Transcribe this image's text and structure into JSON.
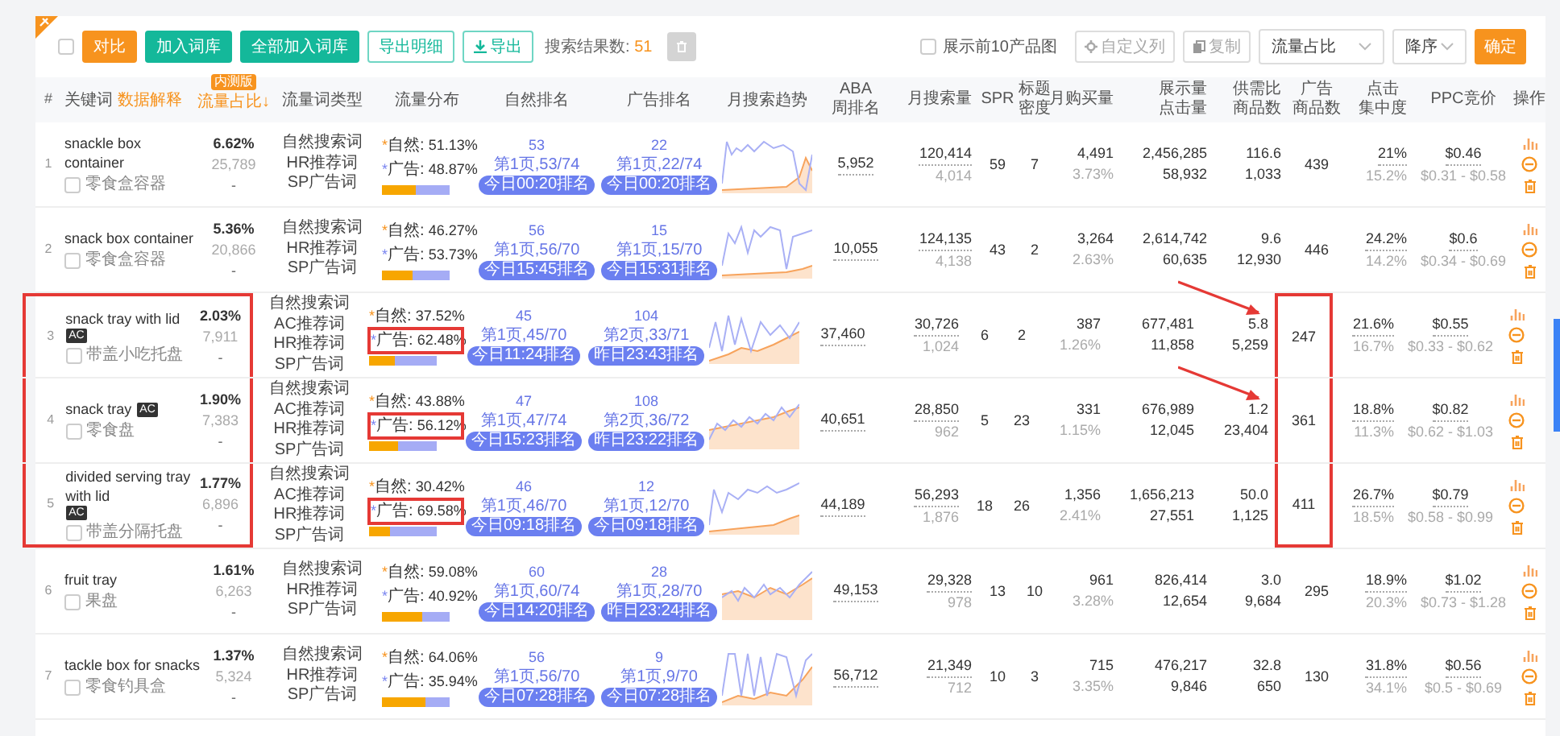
{
  "toolbar": {
    "select_all": {
      "checked": false
    },
    "buttons": [
      {
        "kind": "orange",
        "label": "对比"
      },
      {
        "kind": "green",
        "label": "加入词库"
      },
      {
        "kind": "green",
        "label": "全部加入词库"
      },
      {
        "kind": "outline",
        "label": "导出明细"
      },
      {
        "kind": "outline-download",
        "label": "导出"
      }
    ],
    "result_label": "搜索结果数:",
    "result_count": "51",
    "show_top10": {
      "label": "展示前10产品图",
      "checked": false
    },
    "custom_columns": "自定义列",
    "copy": "复制",
    "sort_field": "流量占比",
    "sort_order": "降序",
    "confirm": "确定"
  },
  "columns": {
    "index": "#",
    "keyword": "关键词",
    "keyword_link": "数据解释",
    "share_badge": "内测版",
    "share": "流量占比↓",
    "type": "流量词类型",
    "distribution": "流量分布",
    "natural_rank": "自然排名",
    "ad_rank": "广告排名",
    "trend": "月搜索趋势",
    "aba": [
      "ABA",
      "周排名"
    ],
    "search": [
      "月搜索量"
    ],
    "spr": [
      "SPR"
    ],
    "density": [
      "标题",
      "密度"
    ],
    "purchases": [
      "月购买量"
    ],
    "impressions": [
      "展示量",
      "点击量"
    ],
    "supply": [
      "供需比",
      "商品数"
    ],
    "ad_products": [
      "广告",
      "商品数"
    ],
    "click": [
      "点击",
      "集中度"
    ],
    "ppc": [
      "PPC竞价"
    ],
    "actions": [
      "操作"
    ]
  },
  "rows": [
    {
      "index": "1",
      "checked": false,
      "keyword": "snackle box container",
      "translation": "零食盒容器",
      "share": "6.62%",
      "volume": "25,789",
      "share_note": "-",
      "types": [
        "自然搜索词",
        "HR推荐词",
        "SP广告词"
      ],
      "distribution": {
        "natural_label": "*自然:",
        "natural": "51.13%",
        "ad_label": "*广告:",
        "ad": "48.87%",
        "level": 0.5113
      },
      "natural_rank": {
        "rank": "53",
        "page": "第1页,53/74",
        "tag": "今日00:20排名"
      },
      "ad_rank": {
        "rank": "22",
        "page": "第1页,22/74",
        "tag": "今日00:20排名"
      },
      "aba": "5,952",
      "search": "120,414",
      "search_sub": "4,014",
      "spr": "59",
      "density": "7",
      "purchases": "4,491",
      "purchase_rate": "3.73%",
      "impressions": "2,456,285",
      "clicks": "58,932",
      "supply_ratio": "116.6",
      "products": "1,033",
      "ad_products": "439",
      "click_share": "21%",
      "click_sub": "15.2%",
      "ppc": "$0.46",
      "ppc_range": "$0.31 - $0.58",
      "annotated": false,
      "arrow": false
    },
    {
      "index": "2",
      "checked": false,
      "keyword": "snack box container",
      "translation": "零食盒容器",
      "share": "5.36%",
      "volume": "20,866",
      "share_note": "-",
      "types": [
        "自然搜索词",
        "HR推荐词",
        "SP广告词"
      ],
      "distribution": {
        "natural_label": "*自然:",
        "natural": "46.27%",
        "ad_label": "*广告:",
        "ad": "53.73%",
        "level": 0.4627
      },
      "natural_rank": {
        "rank": "56",
        "page": "第1页,56/70",
        "tag": "今日15:45排名"
      },
      "ad_rank": {
        "rank": "15",
        "page": "第1页,15/70",
        "tag": "今日15:31排名"
      },
      "aba": "10,055",
      "search": "124,135",
      "search_sub": "4,138",
      "spr": "43",
      "density": "2",
      "purchases": "3,264",
      "purchase_rate": "2.63%",
      "impressions": "2,614,742",
      "clicks": "60,635",
      "supply_ratio": "9.6",
      "products": "12,930",
      "ad_products": "446",
      "click_share": "24.2%",
      "click_sub": "14.2%",
      "ppc": "$0.6",
      "ppc_range": "$0.34 - $0.69",
      "annotated": false,
      "arrow": false
    },
    {
      "index": "3",
      "checked": false,
      "keyword": "snack tray with lid",
      "badge": "AC",
      "translation": "带盖小吃托盘",
      "share": "2.03%",
      "volume": "7,911",
      "share_note": "-",
      "types": [
        "自然搜索词",
        "AC推荐词",
        "HR推荐词",
        "SP广告词"
      ],
      "distribution": {
        "natural_label": "*自然:",
        "natural": "37.52%",
        "ad_label": "*广告:",
        "ad": "62.48%",
        "level": 0.3752
      },
      "natural_rank": {
        "rank": "45",
        "page": "第1页,45/70",
        "tag": "今日11:24排名"
      },
      "ad_rank": {
        "rank": "104",
        "page": "第2页,33/71",
        "tag": "昨日23:43排名"
      },
      "aba": "37,460",
      "search": "30,726",
      "search_sub": "1,024",
      "spr": "6",
      "density": "2",
      "purchases": "387",
      "purchase_rate": "1.26%",
      "impressions": "677,481",
      "clicks": "11,858",
      "supply_ratio": "5.8",
      "products": "5,259",
      "ad_products": "247",
      "click_share": "21.6%",
      "click_sub": "16.7%",
      "ppc": "$0.55",
      "ppc_range": "$0.33 - $0.62",
      "annotated": true,
      "arrow": true
    },
    {
      "index": "4",
      "checked": false,
      "keyword": "snack tray",
      "badge": "AC",
      "translation": "零食盘",
      "share": "1.90%",
      "volume": "7,383",
      "share_note": "-",
      "types": [
        "自然搜索词",
        "AC推荐词",
        "HR推荐词",
        "SP广告词"
      ],
      "distribution": {
        "natural_label": "*自然:",
        "natural": "43.88%",
        "ad_label": "*广告:",
        "ad": "56.12%",
        "level": 0.4388
      },
      "natural_rank": {
        "rank": "47",
        "page": "第1页,47/74",
        "tag": "今日15:23排名"
      },
      "ad_rank": {
        "rank": "108",
        "page": "第2页,36/72",
        "tag": "昨日23:22排名"
      },
      "aba": "40,651",
      "search": "28,850",
      "search_sub": "962",
      "spr": "5",
      "density": "23",
      "purchases": "331",
      "purchase_rate": "1.15%",
      "impressions": "676,989",
      "clicks": "12,045",
      "supply_ratio": "1.2",
      "products": "23,404",
      "ad_products": "361",
      "click_share": "18.8%",
      "click_sub": "11.3%",
      "ppc": "$0.82",
      "ppc_range": "$0.62 - $1.03",
      "annotated": true,
      "arrow": true
    },
    {
      "index": "5",
      "checked": false,
      "keyword": "divided serving tray with lid",
      "badge": "AC",
      "translation": "带盖分隔托盘",
      "share": "1.77%",
      "volume": "6,896",
      "share_note": "-",
      "types": [
        "自然搜索词",
        "AC推荐词",
        "HR推荐词",
        "SP广告词"
      ],
      "distribution": {
        "natural_label": "*自然:",
        "natural": "30.42%",
        "ad_label": "*广告:",
        "ad": "69.58%",
        "level": 0.3042
      },
      "natural_rank": {
        "rank": "46",
        "page": "第1页,46/70",
        "tag": "今日09:18排名"
      },
      "ad_rank": {
        "rank": "12",
        "page": "第1页,12/70",
        "tag": "今日09:18排名"
      },
      "aba": "44,189",
      "search": "56,293",
      "search_sub": "1,876",
      "spr": "18",
      "density": "26",
      "purchases": "1,356",
      "purchase_rate": "2.41%",
      "impressions": "1,656,213",
      "clicks": "27,551",
      "supply_ratio": "50.0",
      "products": "1,125",
      "ad_products": "411",
      "click_share": "26.7%",
      "click_sub": "18.5%",
      "ppc": "$0.79",
      "ppc_range": "$0.58 - $0.99",
      "annotated": true,
      "arrow": false
    },
    {
      "index": "6",
      "checked": false,
      "keyword": "fruit tray",
      "translation": "果盘",
      "share": "1.61%",
      "volume": "6,263",
      "share_note": "-",
      "types": [
        "自然搜索词",
        "HR推荐词",
        "SP广告词"
      ],
      "distribution": {
        "natural_label": "*自然:",
        "natural": "59.08%",
        "ad_label": "*广告:",
        "ad": "40.92%",
        "level": 0.5908
      },
      "natural_rank": {
        "rank": "60",
        "page": "第1页,60/74",
        "tag": "今日14:20排名"
      },
      "ad_rank": {
        "rank": "28",
        "page": "第1页,28/70",
        "tag": "昨日23:24排名"
      },
      "aba": "49,153",
      "search": "29,328",
      "search_sub": "978",
      "spr": "13",
      "density": "10",
      "purchases": "961",
      "purchase_rate": "3.28%",
      "impressions": "826,414",
      "clicks": "12,654",
      "supply_ratio": "3.0",
      "products": "9,684",
      "ad_products": "295",
      "click_share": "18.9%",
      "click_sub": "20.3%",
      "ppc": "$1.02",
      "ppc_range": "$0.73 - $1.28",
      "annotated": false,
      "arrow": false
    },
    {
      "index": "7",
      "checked": false,
      "keyword": "tackle box for snacks",
      "translation": "零食钓具盒",
      "share": "1.37%",
      "volume": "5,324",
      "share_note": "-",
      "types": [
        "自然搜索词",
        "HR推荐词",
        "SP广告词"
      ],
      "distribution": {
        "natural_label": "*自然:",
        "natural": "64.06%",
        "ad_label": "*广告:",
        "ad": "35.94%",
        "level": 0.6406
      },
      "natural_rank": {
        "rank": "56",
        "page": "第1页,56/70",
        "tag": "今日07:28排名"
      },
      "ad_rank": {
        "rank": "9",
        "page": "第1页,9/70",
        "tag": "今日07:28排名"
      },
      "aba": "56,712",
      "search": "21,349",
      "search_sub": "712",
      "spr": "10",
      "density": "3",
      "purchases": "715",
      "purchase_rate": "3.35%",
      "impressions": "476,217",
      "clicks": "9,846",
      "supply_ratio": "32.8",
      "products": "650",
      "ad_products": "130",
      "click_share": "31.8%",
      "click_sub": "34.1%",
      "ppc": "$0.56",
      "ppc_range": "$0.5 - $0.69",
      "annotated": false,
      "arrow": false
    }
  ]
}
